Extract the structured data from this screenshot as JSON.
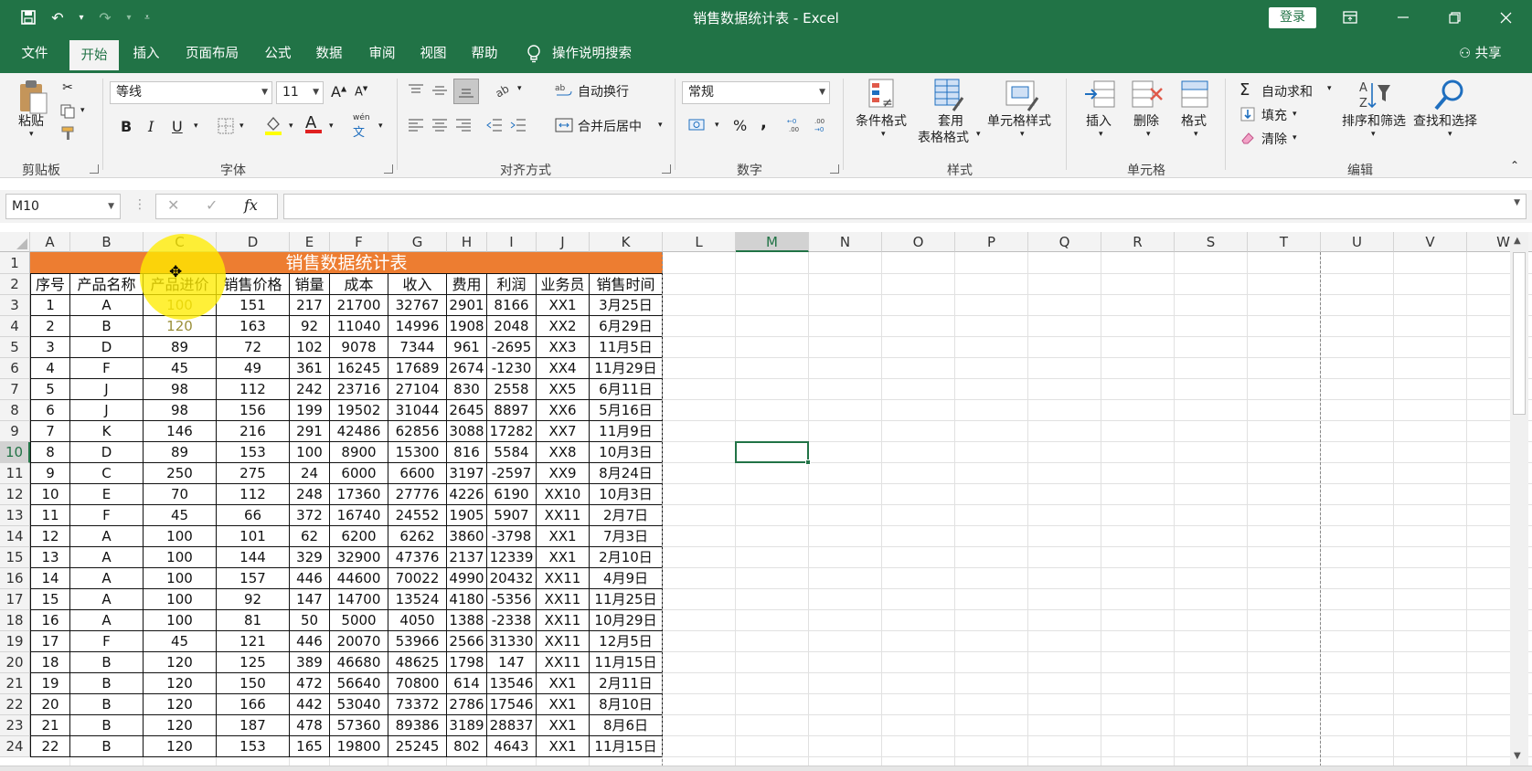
{
  "window": {
    "title": "销售数据统计表  -  Excel",
    "login_label": "登录"
  },
  "tabs": [
    {
      "label": "文件"
    },
    {
      "label": "开始"
    },
    {
      "label": "插入"
    },
    {
      "label": "页面布局"
    },
    {
      "label": "公式"
    },
    {
      "label": "数据"
    },
    {
      "label": "审阅"
    },
    {
      "label": "视图"
    },
    {
      "label": "帮助"
    }
  ],
  "tell_me": "操作说明搜索",
  "share": "共享",
  "ribbon": {
    "clipboard": {
      "paste": "粘贴",
      "label": "剪贴板"
    },
    "font": {
      "name": "等线",
      "size": "11",
      "label": "字体",
      "bold": "B",
      "italic": "I",
      "underline": "U",
      "grow": "A",
      "shrink": "A",
      "color_letter": "A",
      "phonetic": "wén"
    },
    "alignment": {
      "wrap": "自动换行",
      "merge": "合并后居中",
      "label": "对齐方式"
    },
    "number": {
      "format": "常规",
      "label": "数字",
      "percent": "%",
      "comma": ","
    },
    "styles": {
      "conditional": "条件格式",
      "table_1": "套用",
      "table_2": "表格格式",
      "cell_styles": "单元格样式",
      "label": "样式"
    },
    "cells": {
      "insert": "插入",
      "delete": "删除",
      "format": "格式",
      "label": "单元格"
    },
    "editing": {
      "autosum": "自动求和",
      "fill": "填充",
      "clear": "清除",
      "sort": "排序和筛选",
      "find": "查找和选择",
      "label": "编辑"
    }
  },
  "formula_bar": {
    "name_box": "M10",
    "fx": "fx",
    "value": ""
  },
  "columns": [
    "A",
    "B",
    "C",
    "D",
    "E",
    "F",
    "G",
    "H",
    "I",
    "J",
    "K",
    "L",
    "M",
    "N",
    "O",
    "P",
    "Q",
    "R",
    "S",
    "T",
    "U",
    "V",
    "W"
  ],
  "selected_column": "M",
  "selected_row": "10",
  "row_numbers": [
    "1",
    "2",
    "3",
    "4",
    "5",
    "6",
    "7",
    "8",
    "9",
    "10",
    "11",
    "12",
    "13",
    "14",
    "15",
    "16",
    "17",
    "18",
    "19",
    "20",
    "21",
    "22",
    "23",
    "24"
  ],
  "sheet": {
    "title": "销售数据统计表",
    "headers": [
      "序号",
      "产品名称",
      "产品进价",
      "销售价格",
      "销量",
      "成本",
      "收入",
      "费用",
      "利润",
      "业务员",
      "销售时间"
    ],
    "rows": [
      [
        "1",
        "A",
        "100",
        "151",
        "217",
        "21700",
        "32767",
        "2901",
        "8166",
        "XX1",
        "3月25日"
      ],
      [
        "2",
        "B",
        "120",
        "163",
        "92",
        "11040",
        "14996",
        "1908",
        "2048",
        "XX2",
        "6月29日"
      ],
      [
        "3",
        "D",
        "89",
        "72",
        "102",
        "9078",
        "7344",
        "961",
        "-2695",
        "XX3",
        "11月5日"
      ],
      [
        "4",
        "F",
        "45",
        "49",
        "361",
        "16245",
        "17689",
        "2674",
        "-1230",
        "XX4",
        "11月29日"
      ],
      [
        "5",
        "J",
        "98",
        "112",
        "242",
        "23716",
        "27104",
        "830",
        "2558",
        "XX5",
        "6月11日"
      ],
      [
        "6",
        "J",
        "98",
        "156",
        "199",
        "19502",
        "31044",
        "2645",
        "8897",
        "XX6",
        "5月16日"
      ],
      [
        "7",
        "K",
        "146",
        "216",
        "291",
        "42486",
        "62856",
        "3088",
        "17282",
        "XX7",
        "11月9日"
      ],
      [
        "8",
        "D",
        "89",
        "153",
        "100",
        "8900",
        "15300",
        "816",
        "5584",
        "XX8",
        "10月3日"
      ],
      [
        "9",
        "C",
        "250",
        "275",
        "24",
        "6000",
        "6600",
        "3197",
        "-2597",
        "XX9",
        "8月24日"
      ],
      [
        "10",
        "E",
        "70",
        "112",
        "248",
        "17360",
        "27776",
        "4226",
        "6190",
        "XX10",
        "10月3日"
      ],
      [
        "11",
        "F",
        "45",
        "66",
        "372",
        "16740",
        "24552",
        "1905",
        "5907",
        "XX11",
        "2月7日"
      ],
      [
        "12",
        "A",
        "100",
        "101",
        "62",
        "6200",
        "6262",
        "3860",
        "-3798",
        "XX1",
        "7月3日"
      ],
      [
        "13",
        "A",
        "100",
        "144",
        "329",
        "32900",
        "47376",
        "2137",
        "12339",
        "XX1",
        "2月10日"
      ],
      [
        "14",
        "A",
        "100",
        "157",
        "446",
        "44600",
        "70022",
        "4990",
        "20432",
        "XX11",
        "4月9日"
      ],
      [
        "15",
        "A",
        "100",
        "92",
        "147",
        "14700",
        "13524",
        "4180",
        "-5356",
        "XX11",
        "11月25日"
      ],
      [
        "16",
        "A",
        "100",
        "81",
        "50",
        "5000",
        "4050",
        "1388",
        "-2338",
        "XX11",
        "10月29日"
      ],
      [
        "17",
        "F",
        "45",
        "121",
        "446",
        "20070",
        "53966",
        "2566",
        "31330",
        "XX11",
        "12月5日"
      ],
      [
        "18",
        "B",
        "120",
        "125",
        "389",
        "46680",
        "48625",
        "1798",
        "147",
        "XX11",
        "11月15日"
      ],
      [
        "19",
        "B",
        "120",
        "150",
        "472",
        "56640",
        "70800",
        "614",
        "13546",
        "XX1",
        "2月11日"
      ],
      [
        "20",
        "B",
        "120",
        "166",
        "442",
        "53040",
        "73372",
        "2786",
        "17546",
        "XX1",
        "8月10日"
      ],
      [
        "21",
        "B",
        "120",
        "187",
        "478",
        "57360",
        "89386",
        "3189",
        "28837",
        "XX1",
        "8月6日"
      ],
      [
        "22",
        "B",
        "120",
        "153",
        "165",
        "19800",
        "25245",
        "802",
        "4643",
        "XX1",
        "11月15日"
      ]
    ]
  },
  "colors": {
    "excel_green": "#217346",
    "title_fill": "#ed7d31",
    "highlight": "#ffec00"
  }
}
